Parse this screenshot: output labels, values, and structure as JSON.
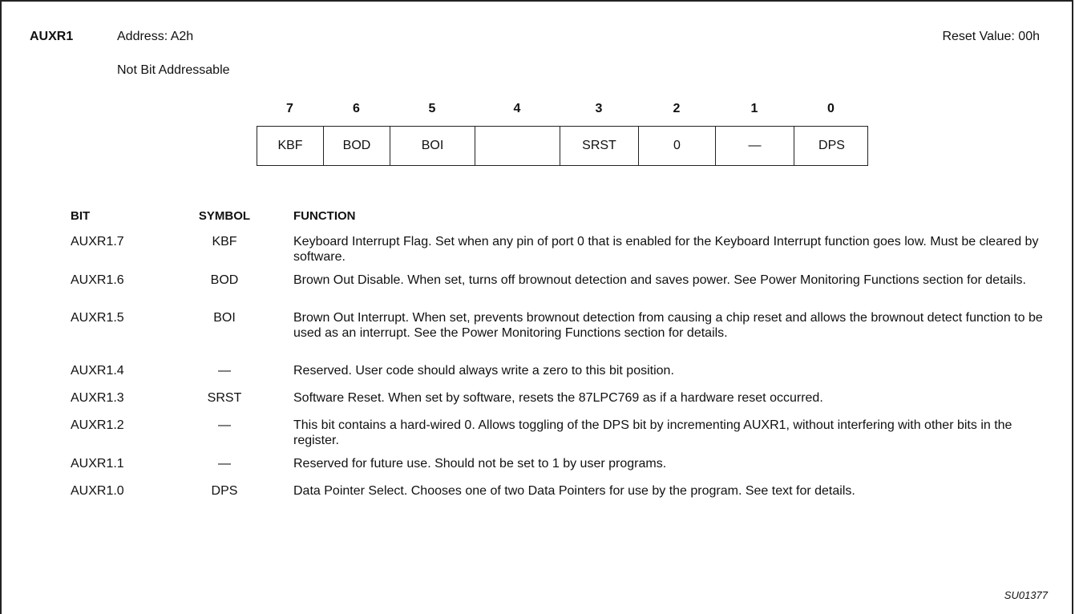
{
  "register": {
    "name": "AUXR1",
    "address": "Address: A2h",
    "addressable": "Not Bit Addressable",
    "reset_value": "Reset Value: 00h"
  },
  "bit_numbers": [
    "7",
    "6",
    "5",
    "4",
    "3",
    "2",
    "1",
    "0"
  ],
  "bit_cells": [
    "KBF",
    "BOD",
    "BOI",
    "",
    "SRST",
    "0",
    "—",
    "DPS"
  ],
  "table": {
    "headers": {
      "bit": "BIT",
      "symbol": "SYMBOL",
      "function": "FUNCTION"
    },
    "rows": [
      {
        "bit": "AUXR1.7",
        "symbol": "KBF",
        "function": "Keyboard Interrupt Flag. Set when any pin of port 0 that is enabled for the Keyboard Interrupt function goes low. Must be cleared by software."
      },
      {
        "bit": "AUXR1.6",
        "symbol": "BOD",
        "function": "Brown Out Disable. When set, turns off brownout detection and saves power. See Power Monitoring Functions section for details."
      },
      {
        "bit": "AUXR1.5",
        "symbol": "BOI",
        "function": "Brown Out Interrupt. When set, prevents brownout detection from causing a chip reset and allows the brownout detect function to be used as an interrupt. See the Power Monitoring Functions section for details."
      },
      {
        "bit": "AUXR1.4",
        "symbol": "—",
        "function": "Reserved. User code should always write a zero to this bit position."
      },
      {
        "bit": "AUXR1.3",
        "symbol": "SRST",
        "function": "Software Reset. When set by software, resets the 87LPC769 as if a hardware reset occurred."
      },
      {
        "bit": "AUXR1.2",
        "symbol": "—",
        "function": "This bit contains a hard-wired 0. Allows toggling of the DPS bit by incrementing AUXR1, without interfering with other bits in the register."
      },
      {
        "bit": "AUXR1.1",
        "symbol": "—",
        "function": "Reserved for future use. Should not be set to 1 by user programs."
      },
      {
        "bit": "AUXR1.0",
        "symbol": "DPS",
        "function": "Data Pointer Select. Chooses one of two Data Pointers for use by the program. See text for details."
      }
    ]
  },
  "figure_id": "SU01377"
}
